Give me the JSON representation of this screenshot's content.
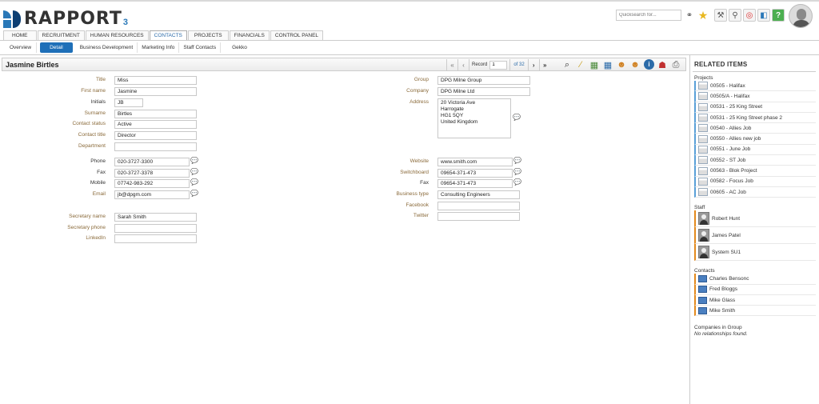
{
  "header": {
    "logo_text": "RAPPORT",
    "logo_sub": "3",
    "quicksearch_placeholder": "Quicksearch for..."
  },
  "main_nav": [
    "HOME",
    "RECRUITMENT",
    "HUMAN RESOURCES",
    "CONTACTS",
    "PROJECTS",
    "FINANCIALS",
    "CONTROL PANEL"
  ],
  "main_nav_active": "CONTACTS",
  "sub_nav": [
    "Overview",
    "Detail",
    "Business Development",
    "Marketing Info",
    "Staff Contacts",
    "Gekko"
  ],
  "sub_nav_active": "Detail",
  "record": {
    "title": "Jasmine Birtles",
    "label": "Record",
    "current": "1",
    "of": "of 32"
  },
  "form": {
    "title": {
      "label": "Title",
      "value": "Miss"
    },
    "first_name": {
      "label": "First name",
      "value": "Jasmine"
    },
    "initials": {
      "label": "Initials",
      "value": "JB"
    },
    "surname": {
      "label": "Surname",
      "value": "Birtles"
    },
    "contact_status": {
      "label": "Contact status",
      "value": "Active"
    },
    "contact_title": {
      "label": "Contact title",
      "value": "Director"
    },
    "department": {
      "label": "Department",
      "value": ""
    },
    "phone": {
      "label": "Phone",
      "value": "020-3727-3300"
    },
    "fax": {
      "label": "Fax",
      "value": "020-3727-3378"
    },
    "mobile": {
      "label": "Mobile",
      "value": "07742-983-292"
    },
    "email": {
      "label": "Email",
      "value": "jb@dpgm.com"
    },
    "secretary_name": {
      "label": "Secretary name",
      "value": "Sarah Smith"
    },
    "secretary_phone": {
      "label": "Secretary phone",
      "value": ""
    },
    "linkedin": {
      "label": "LinkedIn",
      "value": ""
    },
    "group": {
      "label": "Group",
      "value": "DPG Milne Group"
    },
    "company": {
      "label": "Company",
      "value": "DPG Milne Ltd"
    },
    "address": {
      "label": "Address",
      "value": "20 Victoria Ave\nHarrogate\nHG1 5QY\nUnited Kingdom"
    },
    "website": {
      "label": "Website",
      "value": "www.smith.com"
    },
    "switchboard": {
      "label": "Switchboard",
      "value": "09654-371-473"
    },
    "fax2": {
      "label": "Fax",
      "value": "09654-371-473"
    },
    "business_type": {
      "label": "Business type",
      "value": "Consulting Engineers"
    },
    "facebook": {
      "label": "Facebook",
      "value": ""
    },
    "twitter": {
      "label": "Twitter",
      "value": ""
    }
  },
  "related": {
    "title": "RELATED ITEMS",
    "projects_title": "Projects",
    "projects": [
      "00505 - Halifax",
      "00505/A - Halifax",
      "00531 - 25 King Street",
      "00531 - 25 King Street phase 2",
      "00540 - Allies Job",
      "00550 - Allies new job",
      "00551 - June Job",
      "00552 - ST Job",
      "00563 - Blok Project",
      "00582 - Focus Job",
      "00605 - AC Job"
    ],
    "staff_title": "Staff",
    "staff": [
      "Robert Hunt",
      "James Patel",
      "System SU1"
    ],
    "contacts_title": "Contacts",
    "contacts": [
      "Charles Bensonc",
      "Fred Bloggs",
      "Mike Glass",
      "Mike Smith"
    ],
    "companies_title": "Companies in Group",
    "companies_empty": "No relationships found."
  },
  "colors": {
    "accent": "#1e6fb8",
    "label": "#8a6a3a",
    "project_bar": "#5aa0d8",
    "staff_bar": "#e38a1e"
  }
}
